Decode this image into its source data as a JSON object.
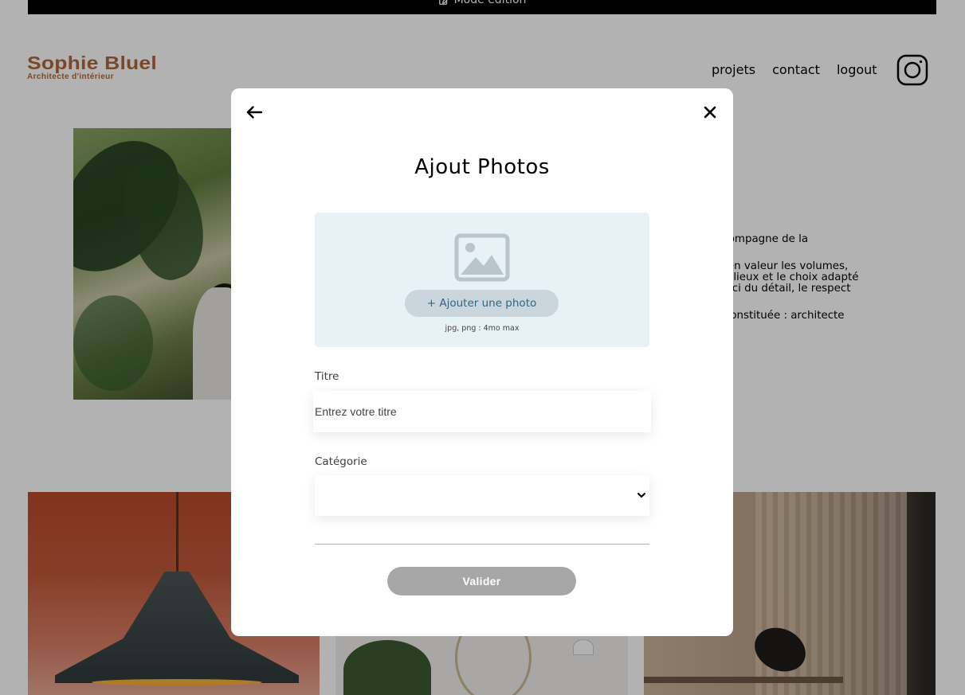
{
  "edit_bar": {
    "label": "Mode édition",
    "icon": "edit-icon"
  },
  "header": {
    "logo_name": "Sophie Bluel",
    "logo_subtitle": "Architecte d'intérieur",
    "nav": [
      "projets",
      "contact",
      "logout"
    ],
    "instagram_icon": "instagram-icon"
  },
  "about": {
    "line1": ". Je vous accompagne de la",
    "line2": "on à mettre en valeur les volumes,",
    "line3": "e l'esprit des lieux et le choix adapté",
    "line4": "é dans le souci du détail, le respect",
    "line5": "e peut-être constituée : architecte"
  },
  "modal": {
    "title": "Ajout Photos",
    "back_icon": "arrow-left-icon",
    "close_icon": "close-icon",
    "upload": {
      "icon": "image-placeholder-icon",
      "button_label": "+ Ajouter une photo",
      "hint": "jpg, png : 4mo max"
    },
    "title_field": {
      "label": "Titre",
      "placeholder": "Entrez votre titre",
      "value": ""
    },
    "category_field": {
      "label": "Catégorie",
      "value": ""
    },
    "submit_label": "Valider"
  },
  "colors": {
    "brand": "#B1663C",
    "dropzone_bg": "#E8F1F6",
    "add_photo_bg": "#CBD6DC",
    "add_photo_text": "#306685",
    "submit_disabled": "#A7A7A7",
    "overlay": "rgba(0,0,0,0.30)"
  }
}
